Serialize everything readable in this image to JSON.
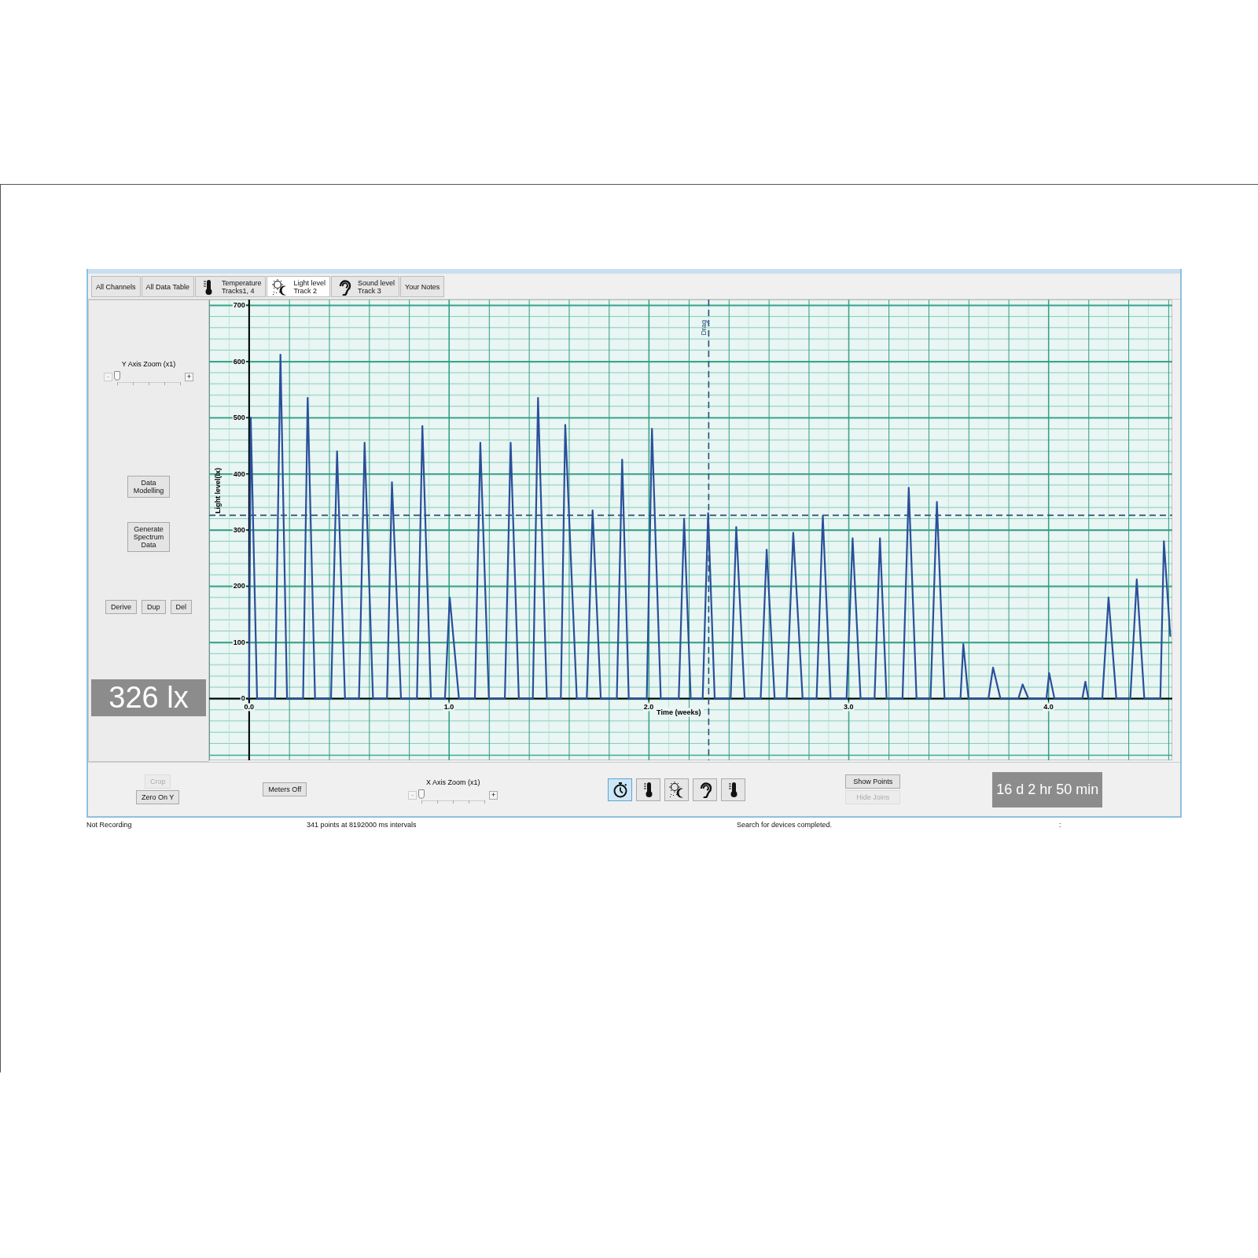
{
  "tabs": [
    {
      "kind": "plain",
      "label": "All Channels",
      "selected": false
    },
    {
      "kind": "plain",
      "label": "All Data Table",
      "selected": false
    },
    {
      "kind": "temperature",
      "label": "Temperature",
      "sublabel": "Tracks1, 4",
      "selected": false
    },
    {
      "kind": "light",
      "label": "Light level",
      "sublabel": "Track 2",
      "selected": true
    },
    {
      "kind": "sound",
      "label": "Sound level",
      "sublabel": "Track 3",
      "selected": false
    },
    {
      "kind": "plain",
      "label": "Your Notes",
      "selected": false
    }
  ],
  "side_panel": {
    "y_zoom": {
      "label": "Y Axis Zoom (x1)",
      "minus": "-",
      "plus": "+",
      "level": 0
    },
    "buttons": [
      {
        "label": "Data Modelling",
        "disabled": false
      },
      {
        "label": "Generate Spectrum Data",
        "disabled": false
      }
    ],
    "track_buttons": [
      {
        "label": "Derive",
        "disabled": false
      },
      {
        "label": "Dup",
        "disabled": false
      },
      {
        "label": "Del",
        "disabled": false
      }
    ],
    "readout": "326 lx"
  },
  "chart": {
    "chart_data": {
      "type": "line",
      "xlabel": "Time (weeks)",
      "ylabel": "Light level(lx)",
      "xlim": [
        -0.2,
        4.62
      ],
      "ylim": [
        -110,
        710
      ],
      "xticks": [
        {
          "value": 0,
          "label": "0.0"
        },
        {
          "value": 1,
          "label": "1.0"
        },
        {
          "value": 2,
          "label": "2.0"
        },
        {
          "value": 3,
          "label": "3.0"
        },
        {
          "value": 4,
          "label": "4.0"
        }
      ],
      "yticks": [
        0,
        100,
        200,
        300,
        400,
        500,
        600,
        700
      ],
      "x": [
        0.0,
        0.008,
        0.04,
        0.13,
        0.157,
        0.19,
        0.27,
        0.293,
        0.33,
        0.41,
        0.44,
        0.48,
        0.55,
        0.578,
        0.62,
        0.69,
        0.715,
        0.76,
        0.84,
        0.867,
        0.91,
        0.98,
        1.004,
        1.05,
        1.13,
        1.157,
        1.2,
        1.28,
        1.309,
        1.35,
        1.42,
        1.446,
        1.49,
        1.56,
        1.582,
        1.64,
        1.69,
        1.719,
        1.76,
        1.84,
        1.867,
        1.9,
        1.99,
        2.016,
        2.06,
        2.15,
        2.177,
        2.21,
        2.27,
        2.297,
        2.33,
        2.41,
        2.438,
        2.48,
        2.56,
        2.59,
        2.63,
        2.69,
        2.723,
        2.77,
        2.84,
        2.871,
        2.91,
        2.99,
        3.02,
        3.06,
        3.13,
        3.157,
        3.19,
        3.27,
        3.301,
        3.34,
        3.41,
        3.442,
        3.48,
        3.56,
        3.574,
        3.6,
        3.7,
        3.723,
        3.76,
        3.85,
        3.871,
        3.9,
        3.99,
        4.004,
        4.03,
        4.17,
        4.185,
        4.2,
        4.27,
        4.301,
        4.34,
        4.41,
        4.442,
        4.48,
        4.56,
        4.578,
        4.61
      ],
      "series": [
        {
          "color": "#2a4f9a",
          "values": [
            0,
            500,
            0,
            0,
            612,
            0,
            0,
            535,
            0,
            0,
            440,
            0,
            0,
            455,
            0,
            0,
            385,
            0,
            0,
            485,
            0,
            0,
            180,
            0,
            0,
            455,
            0,
            0,
            455,
            0,
            0,
            535,
            0,
            0,
            487,
            0,
            0,
            335,
            0,
            0,
            425,
            0,
            0,
            480,
            0,
            0,
            320,
            0,
            0,
            330,
            0,
            0,
            305,
            0,
            0,
            265,
            0,
            0,
            295,
            0,
            0,
            325,
            0,
            0,
            285,
            0,
            0,
            285,
            0,
            0,
            375,
            0,
            0,
            350,
            0,
            0,
            97,
            0,
            0,
            55,
            0,
            0,
            25,
            0,
            0,
            45,
            0,
            0,
            30,
            0,
            0,
            180,
            0,
            0,
            212,
            0,
            0,
            280,
            110
          ]
        }
      ],
      "grid": true,
      "ref_lines": [
        {
          "axis": "y",
          "value": 326
        },
        {
          "axis": "x",
          "value": 2.3,
          "label": "Drag"
        }
      ]
    }
  },
  "bottom_bar": {
    "crop_buttons": [
      {
        "label": "Crop",
        "disabled": true
      },
      {
        "label": "Zero On Y",
        "disabled": false
      }
    ],
    "meters_button": "Meters Off",
    "x_zoom": {
      "label": "X Axis Zoom (x1)",
      "minus": "-",
      "plus": "+",
      "level": 0
    },
    "channel_buttons": [
      {
        "kind": "time",
        "selected": true
      },
      {
        "kind": "temperature",
        "selected": false
      },
      {
        "kind": "light",
        "selected": false
      },
      {
        "kind": "sound",
        "selected": false
      },
      {
        "kind": "temperature",
        "selected": false
      }
    ],
    "view_buttons": [
      {
        "label": "Show Points",
        "disabled": false
      },
      {
        "label": "Hide Joins",
        "disabled": true
      }
    ],
    "readout": "16 d 2 hr 50 min"
  },
  "status_bar": [
    "Not Recording",
    "341 points at 8192000 ms intervals",
    "Search for devices completed.",
    ":"
  ]
}
